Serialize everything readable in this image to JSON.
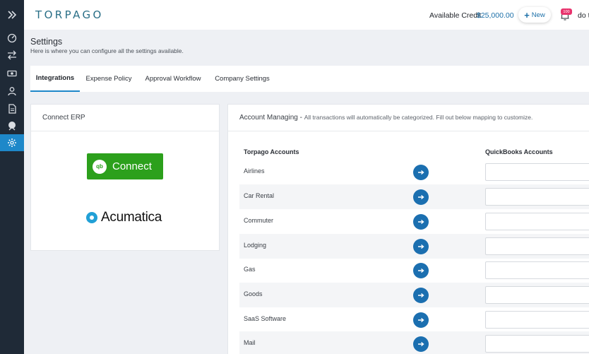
{
  "sidebar": {
    "items": [
      {
        "icon": "chevrons-right-icon"
      },
      {
        "icon": "speedometer-icon"
      },
      {
        "icon": "transfer-arrows-icon"
      },
      {
        "icon": "cash-icon"
      },
      {
        "icon": "user-icon"
      },
      {
        "icon": "document-icon"
      },
      {
        "icon": "plane-globe-icon"
      },
      {
        "icon": "gear-icon",
        "active": true
      }
    ],
    "active_color": "#1e88c9"
  },
  "header": {
    "logo": "TORPAGO",
    "credit_label": "Available Credit",
    "credit_value": "$25,000.00",
    "new_label": "New",
    "badge": "100",
    "user_text": "do t"
  },
  "page": {
    "title": "Settings",
    "subtitle": "Here is where you can configure all the settings available."
  },
  "tabs": [
    {
      "label": "Integrations",
      "active": true
    },
    {
      "label": "Expense Policy"
    },
    {
      "label": "Approval Workflow"
    },
    {
      "label": "Company Settings"
    }
  ],
  "erp": {
    "title": "Connect ERP",
    "quickbooks_logo": "qb",
    "quickbooks_label": "Connect",
    "acumatica_label": "Acumatica"
  },
  "accounts": {
    "title": "Account Managing -",
    "description": "All transactions will automatically be categorized. Fill out below mapping to customize.",
    "col_left": "Torpago Accounts",
    "col_right": "QuickBooks Accounts",
    "rows": [
      {
        "name": "Airlines",
        "value": ""
      },
      {
        "name": "Car Rental",
        "value": ""
      },
      {
        "name": "Commuter",
        "value": ""
      },
      {
        "name": "Lodging",
        "value": ""
      },
      {
        "name": "Gas",
        "value": ""
      },
      {
        "name": "Goods",
        "value": ""
      },
      {
        "name": "SaaS Software",
        "value": ""
      },
      {
        "name": "Mail",
        "value": ""
      }
    ]
  },
  "colors": {
    "brand_blue": "#1b6fa8",
    "quickbooks_green": "#2ca01c",
    "badge_pink": "#e8336d"
  }
}
